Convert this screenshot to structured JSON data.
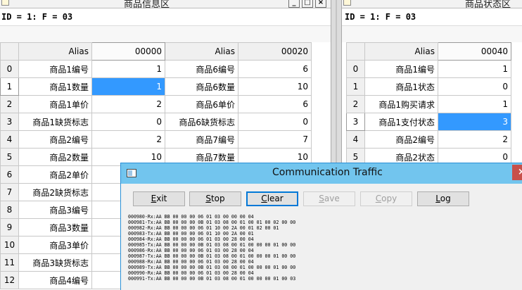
{
  "window1": {
    "title": "商品信息区",
    "ctrl_min": "_",
    "ctrl_max": "□",
    "ctrl_close": "×",
    "status": "ID = 1: F = 03",
    "grid": {
      "headers": [
        "",
        "Alias",
        "00000",
        "Alias",
        "00020"
      ],
      "rows": [
        {
          "n": "0",
          "a1": "商品1编号",
          "v1": "1",
          "a2": "商品6编号",
          "v2": "6"
        },
        {
          "n": "1",
          "a1": "商品1数量",
          "v1": "1",
          "a2": "商品6数量",
          "v2": "10"
        },
        {
          "n": "2",
          "a1": "商品1单价",
          "v1": "2",
          "a2": "商品6单价",
          "v2": "6"
        },
        {
          "n": "3",
          "a1": "商品1缺货标志",
          "v1": "0",
          "a2": "商品6缺货标志",
          "v2": "0"
        },
        {
          "n": "4",
          "a1": "商品2编号",
          "v1": "2",
          "a2": "商品7编号",
          "v2": "7"
        },
        {
          "n": "5",
          "a1": "商品2数量",
          "v1": "10",
          "a2": "商品7数量",
          "v2": "10"
        },
        {
          "n": "6",
          "a1": "商品2单价",
          "v1": "",
          "a2": "",
          "v2": ""
        },
        {
          "n": "7",
          "a1": "商品2缺货标志",
          "v1": "",
          "a2": "",
          "v2": ""
        },
        {
          "n": "8",
          "a1": "商品3编号",
          "v1": "",
          "a2": "",
          "v2": ""
        },
        {
          "n": "9",
          "a1": "商品3数量",
          "v1": "",
          "a2": "",
          "v2": ""
        },
        {
          "n": "10",
          "a1": "商品3单价",
          "v1": "",
          "a2": "",
          "v2": ""
        },
        {
          "n": "11",
          "a1": "商品3缺货标志",
          "v1": "",
          "a2": "",
          "v2": ""
        },
        {
          "n": "12",
          "a1": "商品4编号",
          "v1": "",
          "a2": "",
          "v2": ""
        }
      ]
    }
  },
  "window2": {
    "title": "商品状态区",
    "status": "ID = 1: F = 03",
    "grid": {
      "headers": [
        "",
        "Alias",
        "00040"
      ],
      "rows": [
        {
          "n": "0",
          "a": "商品1编号",
          "v": "1"
        },
        {
          "n": "1",
          "a": "商品1状态",
          "v": "0"
        },
        {
          "n": "2",
          "a": "商品1购买请求",
          "v": "1"
        },
        {
          "n": "3",
          "a": "商品1支付状态",
          "v": "3"
        },
        {
          "n": "4",
          "a": "商品2编号",
          "v": "2"
        },
        {
          "n": "5",
          "a": "商品2状态",
          "v": "0"
        }
      ]
    }
  },
  "dialog": {
    "title": "Communication Traffic",
    "close": "×",
    "buttons": {
      "exit": {
        "u": "E",
        "rest": "xit"
      },
      "stop": {
        "u": "S",
        "rest": "top"
      },
      "clear": {
        "u": "C",
        "rest": "lear"
      },
      "save": {
        "u": "S",
        "rest": "ave"
      },
      "copy": {
        "u": "C",
        "rest": "opy"
      },
      "log": {
        "u": "L",
        "rest": "og"
      }
    },
    "log_lines": [
      "000980-Rx:AA BB 00 00 00 06 01 03 00 00 00 04",
      "000981-Tx:AA BB 00 00 00 0B 01 03 08 00 01 00 01 00 02 00 00",
      "000982-Rx:AA BB 00 00 00 06 01 10 00 2A 00 01 02 00 01",
      "000983-Tx:AA BB 00 00 00 06 01 10 00 2A 00 01",
      "000984-Rx:AA BB 00 00 00 06 01 03 00 28 00 04",
      "000985-Tx:AA BB 00 00 00 0B 01 03 08 00 01 00 00 00 01 00 00",
      "000986-Rx:AA BB 00 00 00 06 01 03 00 28 00 04",
      "000987-Tx:AA BB 00 00 00 0B 01 03 08 00 01 00 00 00 01 00 00",
      "000988-Rx:AA BB 00 00 00 06 01 03 00 28 00 04",
      "000989-Tx:AA BB 00 00 00 0B 01 03 08 00 01 00 00 00 01 00 00",
      "000990-Rx:AA BB 00 00 00 06 01 03 00 28 00 04",
      "000991-Tx:AA BB 00 00 00 0B 01 03 08 00 01 00 00 00 01 00 03"
    ]
  },
  "colors": {
    "selection": "#3399ff",
    "dialog_title": "#72c5ee",
    "close_button": "#c7504a"
  }
}
